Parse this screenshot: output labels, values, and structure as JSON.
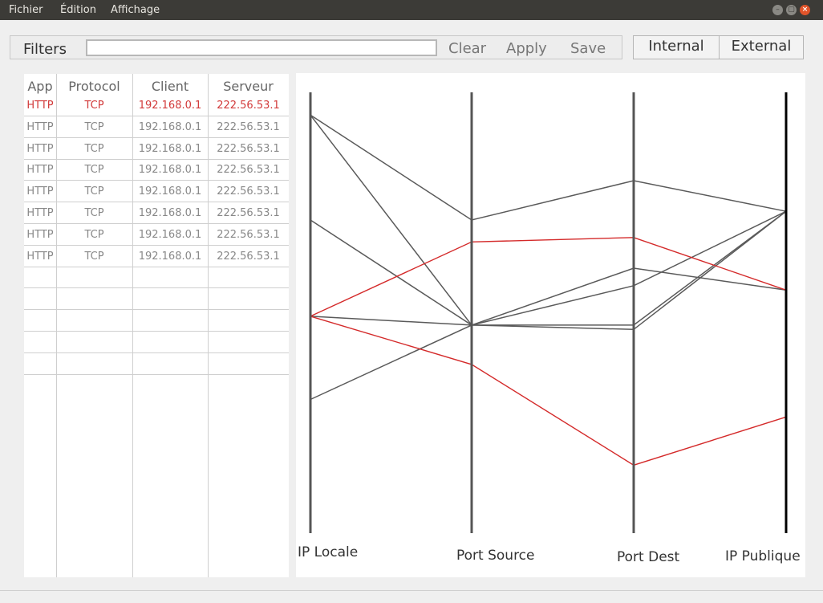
{
  "menubar": {
    "items": [
      {
        "label": "Fichier"
      },
      {
        "label": "Édition"
      },
      {
        "label": "Affichage"
      }
    ],
    "window_buttons": {
      "minimize": "–",
      "maximize": "▢",
      "close": "×"
    }
  },
  "filters": {
    "label": "Filters",
    "input_value": "",
    "clear_label": "Clear",
    "apply_label": "Apply",
    "save_label": "Save"
  },
  "view_toggle": {
    "internal_label": "Internal",
    "external_label": "External"
  },
  "table": {
    "columns": [
      "App",
      "Protocol",
      "Client",
      "Serveur"
    ],
    "rows": [
      {
        "app": "HTTP",
        "protocol": "TCP",
        "client": "192.168.0.1",
        "server": "222.56.53.1",
        "selected": true
      },
      {
        "app": "HTTP",
        "protocol": "TCP",
        "client": "192.168.0.1",
        "server": "222.56.53.1",
        "selected": false
      },
      {
        "app": "HTTP",
        "protocol": "TCP",
        "client": "192.168.0.1",
        "server": "222.56.53.1",
        "selected": false
      },
      {
        "app": "HTTP",
        "protocol": "TCP",
        "client": "192.168.0.1",
        "server": "222.56.53.1",
        "selected": false
      },
      {
        "app": "HTTP",
        "protocol": "TCP",
        "client": "192.168.0.1",
        "server": "222.56.53.1",
        "selected": false
      },
      {
        "app": "HTTP",
        "protocol": "TCP",
        "client": "192.168.0.1",
        "server": "222.56.53.1",
        "selected": false
      },
      {
        "app": "HTTP",
        "protocol": "TCP",
        "client": "192.168.0.1",
        "server": "222.56.53.1",
        "selected": false
      },
      {
        "app": "HTTP",
        "protocol": "TCP",
        "client": "192.168.0.1",
        "server": "222.56.53.1",
        "selected": false
      }
    ]
  },
  "parallel_plot": {
    "axes": [
      "IP Locale",
      "Port Source",
      "Port Dest",
      "IP Publique"
    ],
    "colors": {
      "normal": "#5a5a5a",
      "highlight": "#d42a2a",
      "axis": "#555555",
      "last_axis": "#000000"
    },
    "lines": [
      {
        "values": [
          0.05,
          0.29,
          0.2,
          0.27
        ],
        "highlight": false
      },
      {
        "values": [
          0.05,
          0.53,
          0.53,
          0.27
        ],
        "highlight": false
      },
      {
        "values": [
          0.29,
          0.53,
          0.44,
          0.27
        ],
        "highlight": false
      },
      {
        "values": [
          0.51,
          0.53,
          0.4,
          0.45
        ],
        "highlight": false
      },
      {
        "values": [
          0.7,
          0.53,
          0.54,
          0.27
        ],
        "highlight": false
      },
      {
        "values": [
          0.51,
          0.34,
          0.33,
          0.45
        ],
        "highlight": true
      },
      {
        "values": [
          0.51,
          0.62,
          0.85,
          0.74
        ],
        "highlight": true
      }
    ]
  }
}
